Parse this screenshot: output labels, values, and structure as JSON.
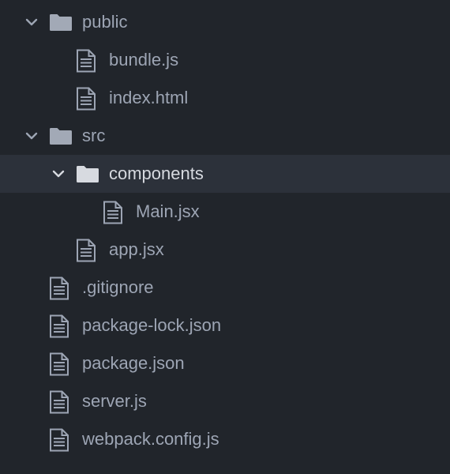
{
  "file_tree": {
    "rows": [
      {
        "type": "folder",
        "label": "public",
        "depth": 0,
        "expanded": true,
        "selected": false,
        "icon": "folder-icon"
      },
      {
        "type": "file",
        "label": "bundle.js",
        "depth": 1,
        "selected": false,
        "icon": "file-text-icon"
      },
      {
        "type": "file",
        "label": "index.html",
        "depth": 1,
        "selected": false,
        "icon": "file-text-icon"
      },
      {
        "type": "folder",
        "label": "src",
        "depth": 0,
        "expanded": true,
        "selected": false,
        "icon": "folder-icon"
      },
      {
        "type": "folder",
        "label": "components",
        "depth": 1,
        "expanded": true,
        "selected": true,
        "icon": "folder-icon"
      },
      {
        "type": "file",
        "label": "Main.jsx",
        "depth": 2,
        "selected": false,
        "icon": "file-text-icon"
      },
      {
        "type": "file",
        "label": "app.jsx",
        "depth": 1,
        "selected": false,
        "icon": "file-text-icon"
      },
      {
        "type": "file",
        "label": ".gitignore",
        "depth": 0,
        "selected": false,
        "icon": "file-text-icon"
      },
      {
        "type": "file",
        "label": "package-lock.json",
        "depth": 0,
        "selected": false,
        "icon": "file-text-icon"
      },
      {
        "type": "file",
        "label": "package.json",
        "depth": 0,
        "selected": false,
        "icon": "file-text-icon"
      },
      {
        "type": "file",
        "label": "server.js",
        "depth": 0,
        "selected": false,
        "icon": "file-text-icon"
      },
      {
        "type": "file",
        "label": "webpack.config.js",
        "depth": 0,
        "selected": false,
        "icon": "file-text-icon"
      }
    ]
  },
  "colors": {
    "background": "#21252b",
    "selected_row": "#2c313a",
    "text": "#9da5b4",
    "selected_text": "#d7dae0",
    "folder_icon": "#a2a9b6",
    "file_icon": "#9da5b4"
  }
}
